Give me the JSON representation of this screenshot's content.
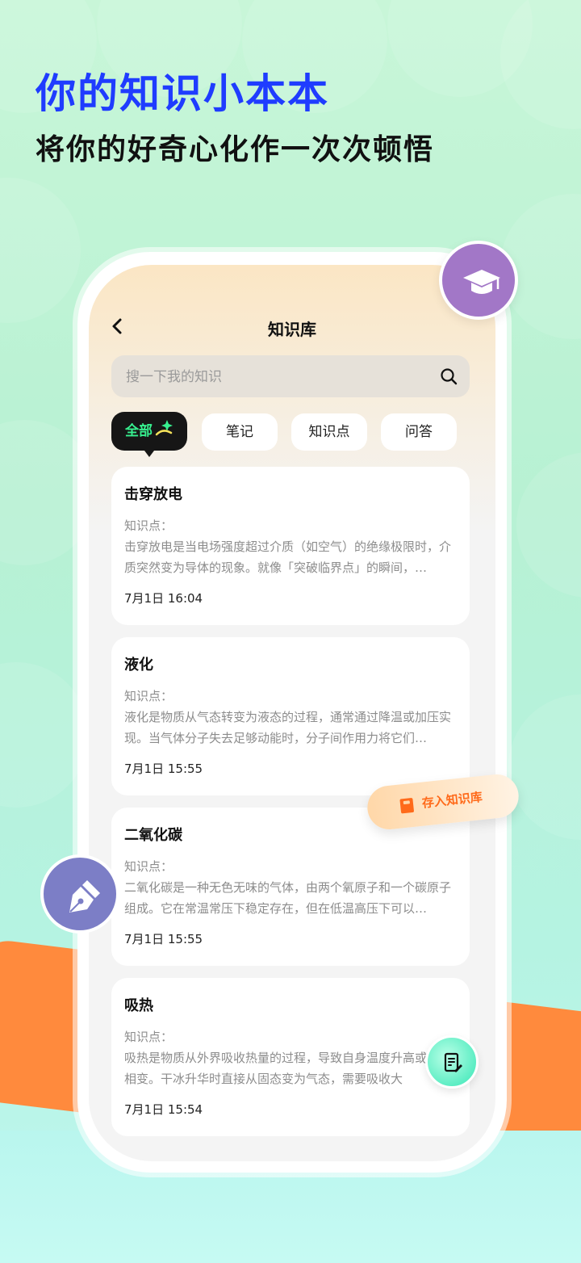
{
  "promo": {
    "headline": "你的知识小本本",
    "subline": "将你的好奇心化作一次次顿悟"
  },
  "app": {
    "nav_title": "知识库",
    "search_placeholder": "搜一下我的知识",
    "tabs": [
      {
        "label": "全部",
        "active": true
      },
      {
        "label": "笔记",
        "active": false
      },
      {
        "label": "知识点",
        "active": false
      },
      {
        "label": "问答",
        "active": false
      }
    ],
    "items": [
      {
        "title": "击穿放电",
        "label": "知识点：",
        "body": "击穿放电是当电场强度超过介质（如空气）的绝缘极限时，介质突然变为导体的现象。就像「突破临界点」的瞬间，…",
        "time": "7月1日 16:04"
      },
      {
        "title": "液化",
        "label": "知识点：",
        "body": "液化是物质从气态转变为液态的过程，通常通过降温或加压实现。当气体分子失去足够动能时，分子间作用力将它们…",
        "time": "7月1日 15:55"
      },
      {
        "title": "二氧化碳",
        "label": "知识点：",
        "body": "二氧化碳是一种无色无味的气体，由两个氧原子和一个碳原子组成。它在常温常压下稳定存在，但在低温高压下可以…",
        "time": "7月1日 15:55"
      },
      {
        "title": "吸热",
        "label": "知识点：",
        "body": "吸热是物质从外界吸收热量的过程，导致自身温度升高或发生相变。干冰升华时直接从固态变为气态，需要吸收大",
        "time": "7月1日 15:54"
      }
    ],
    "save_pill_label": "存入知识库"
  },
  "colors": {
    "headline": "#1f3cff",
    "active_tab_text": "#37f08f",
    "accent_orange": "#ff8a3d",
    "cap_badge": "#a277c7",
    "pen_badge": "#7c7ec6"
  },
  "icons": [
    "graduation-cap-icon",
    "back-arrow-icon",
    "search-icon",
    "sparkle-icon",
    "pen-nib-icon",
    "book-icon",
    "note-edit-icon"
  ]
}
